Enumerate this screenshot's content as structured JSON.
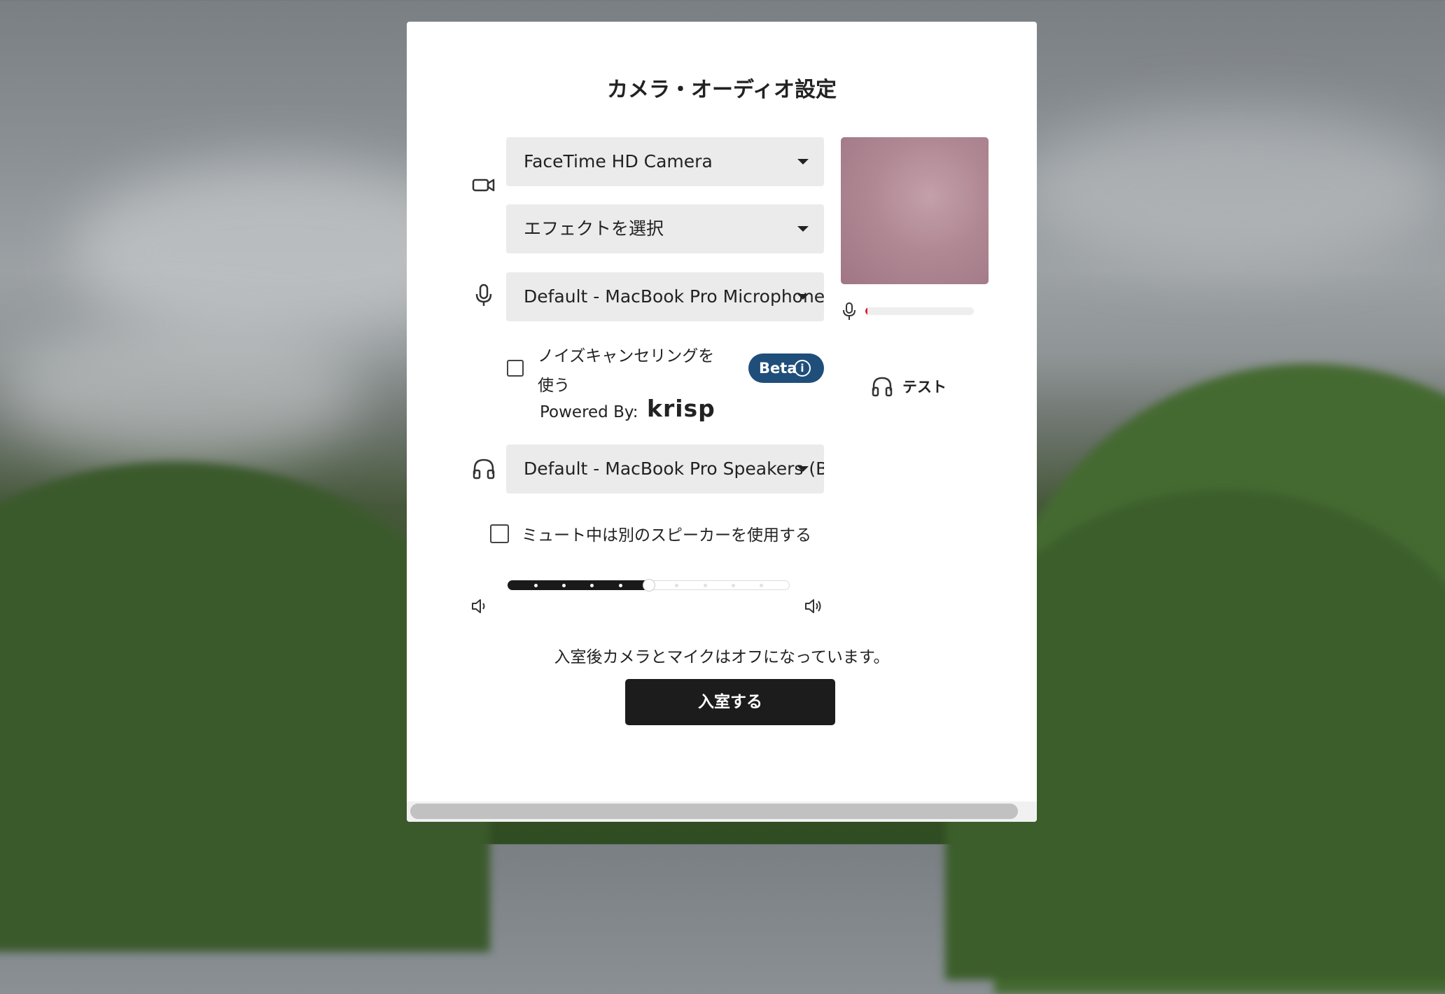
{
  "dialog": {
    "title": "カメラ・オーディオ設定",
    "camera_select": {
      "value": "FaceTime HD Camera"
    },
    "effect_select": {
      "value": "エフェクトを選択"
    },
    "mic_select": {
      "value": "Default - MacBook Pro Microphone (Built-in)"
    },
    "noise_cancel": {
      "label_line1": "ノイズキャンセリングを",
      "label_line2": "使う",
      "checked": false,
      "beta_label": "Beta",
      "info_icon": "i",
      "powered_by": "Powered By:",
      "brand": "krisp"
    },
    "speaker_select": {
      "value": "Default - MacBook Pro Speakers (Built-in)"
    },
    "mute_speaker": {
      "label": "ミュート中は別のスピーカーを使用する",
      "checked": false
    },
    "volume": {
      "level": 0.5,
      "steps": 10
    },
    "notice": "入室後カメラとマイクはオフになっています。",
    "enter_button": "入室する",
    "preview": {
      "mic_level": 0.02,
      "test_label": "テスト"
    }
  },
  "icons": {
    "camera": "camera-icon",
    "mic": "mic-icon",
    "headphones": "headphones-icon",
    "volume_low": "volume-low-icon",
    "volume_high": "volume-high-icon"
  },
  "colors": {
    "beta_bg": "#1f4e7a",
    "button_bg": "#1c1c1c",
    "meter_fill": "#e0202a"
  }
}
